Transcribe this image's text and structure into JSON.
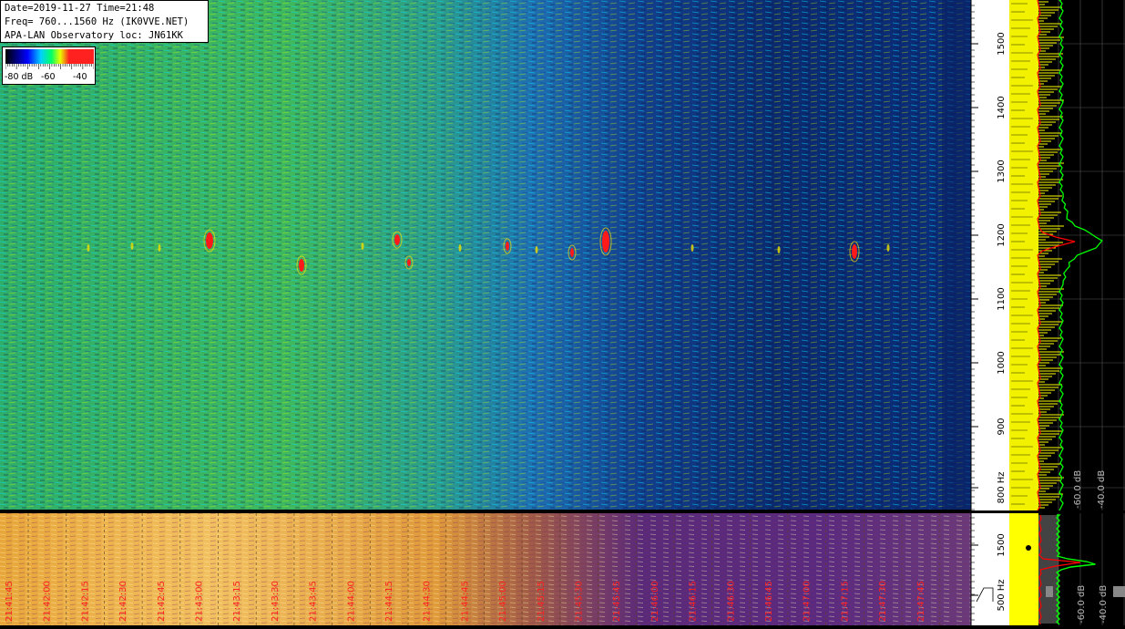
{
  "info": {
    "line1": "Date=2019-11-27 Time=21:48",
    "line2": "Freq= 760...1560 Hz (IK0VVE.NET)",
    "line3": "APA-LAN Observatory loc: JN61KK"
  },
  "legend": {
    "labels": [
      "-80 dB",
      "-60",
      "-40"
    ],
    "colors": [
      "#000000",
      "#0000ff",
      "#00d0ff",
      "#00ff66",
      "#e8ff00",
      "#ff2020"
    ]
  },
  "upper_freq_axis": {
    "ticks": [
      "1500",
      "1400",
      "1300",
      "1200",
      "1100",
      "1000",
      "900",
      "800 Hz"
    ]
  },
  "upper_spectrum_axis": {
    "labels": [
      "-60.0 dB",
      "-40.0 dB"
    ]
  },
  "lower_freq_axis": {
    "ticks": [
      "1500",
      "500 Hz"
    ]
  },
  "lower_spectrum_axis": {
    "labels": [
      "-60.0 dB",
      "-40.0 dB"
    ]
  },
  "time_labels": [
    "21:41:45",
    "21:42:00",
    "21:42:15",
    "21:42:30",
    "21:42:45",
    "21:43:00",
    "21:43:15",
    "21:43:30",
    "21:43:45",
    "21:44:00",
    "21:44:15",
    "21:44:30",
    "21:44:45",
    "21:45:00",
    "21:45:15",
    "21:45:30",
    "21:45:45",
    "21:46:00",
    "21:46:15",
    "21:46:30",
    "21:46:45",
    "21:47:00",
    "21:47:15",
    "21:47:30",
    "21:47:45"
  ],
  "colors": {
    "spectrum_yellow": "#ffff00",
    "spectrum_green": "#00ff00",
    "spectrum_red": "#ff0000",
    "time_label": "#ff2020"
  }
}
